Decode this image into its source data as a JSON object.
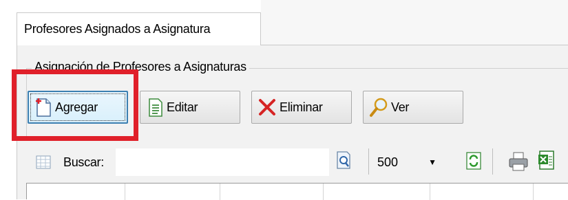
{
  "tab": {
    "label": "Profesores Asignados a Asignatura"
  },
  "group": {
    "title": "Asignación de Profesores a Asignaturas"
  },
  "buttons": {
    "add": {
      "label": "Agregar",
      "icon": "new-document-icon"
    },
    "edit": {
      "label": "Editar",
      "icon": "edit-document-icon"
    },
    "delete": {
      "label": "Eliminar",
      "icon": "red-x-icon"
    },
    "view": {
      "label": "Ver",
      "icon": "magnifier-icon"
    }
  },
  "search": {
    "label": "Buscar:",
    "value": ""
  },
  "page_size": {
    "value": "500"
  },
  "colors": {
    "highlight": "#e0202a",
    "focus": "#3c7fb1"
  }
}
